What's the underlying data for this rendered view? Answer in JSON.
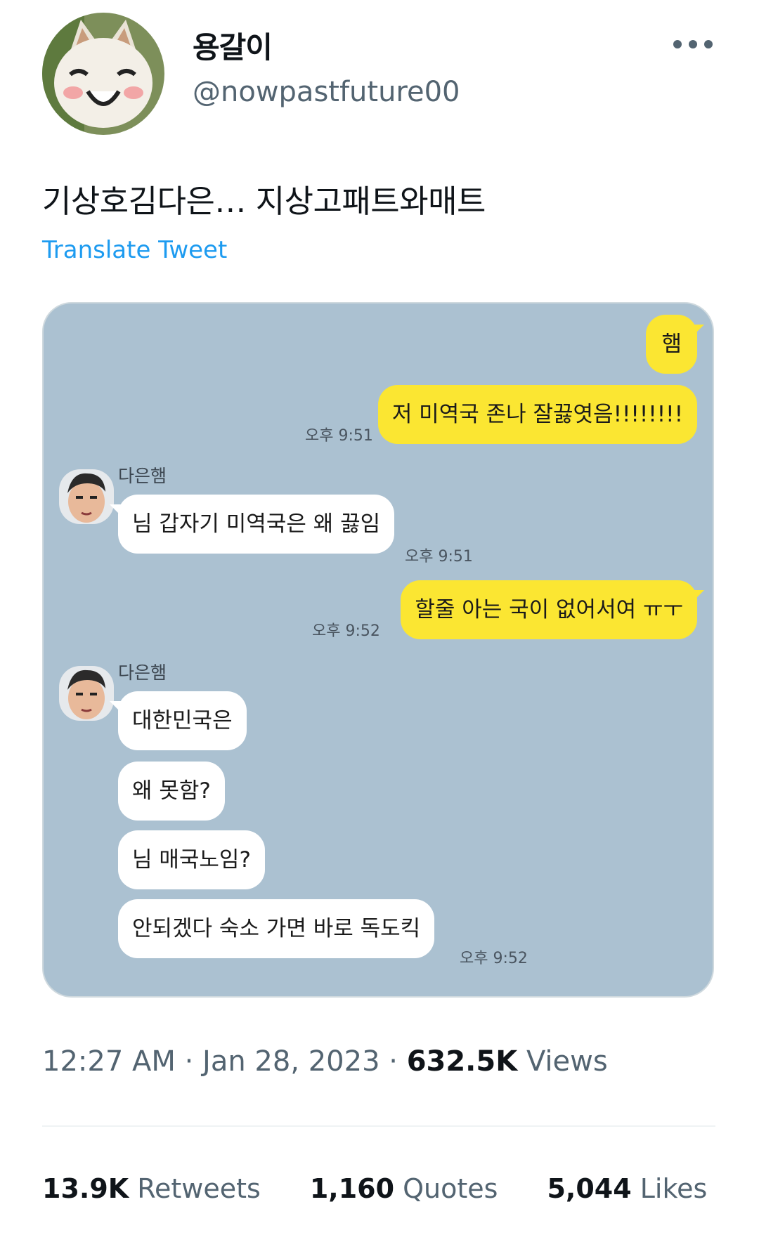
{
  "author": {
    "display_name": "용갈이",
    "handle": "@nowpastfuture00"
  },
  "tweet": {
    "text": "기상호김다은… 지상고패트와매트",
    "translate_label": "Translate Tweet"
  },
  "chat": {
    "messages": [
      {
        "from": "me",
        "text": "햄"
      },
      {
        "from": "me",
        "text": "저 미역국 존나 잘끓엿음!!!!!!!!",
        "time": "오후 9:51"
      },
      {
        "from": "other",
        "sender": "다은햄",
        "text": "님 갑자기 미역국은 왜 끓임",
        "time": "오후 9:51"
      },
      {
        "from": "me",
        "text": "할줄 아는 국이 없어서여 ㅠㅜ",
        "time": "오후 9:52"
      },
      {
        "from": "other",
        "sender": "다은햄",
        "text": "대한민국은"
      },
      {
        "from": "other",
        "text": "왜 못함?"
      },
      {
        "from": "other",
        "text": "님 매국노임?"
      },
      {
        "from": "other",
        "text": "안되겠다 숙소 가면 바로 독도킥",
        "time": "오후 9:52"
      }
    ]
  },
  "meta": {
    "time": "12:27 AM",
    "separator": "·",
    "date": "Jan 28, 2023",
    "views_count": "632.5K",
    "views_label": "Views"
  },
  "stats": {
    "retweets_count": "13.9K",
    "retweets_label": "Retweets",
    "quotes_count": "1,160",
    "quotes_label": "Quotes",
    "likes_count": "5,044",
    "likes_label": "Likes"
  },
  "colors": {
    "accent": "#1d9bf0",
    "chat_bg": "#abc1d1",
    "my_bubble": "#fbe632",
    "other_bubble": "#ffffff"
  }
}
